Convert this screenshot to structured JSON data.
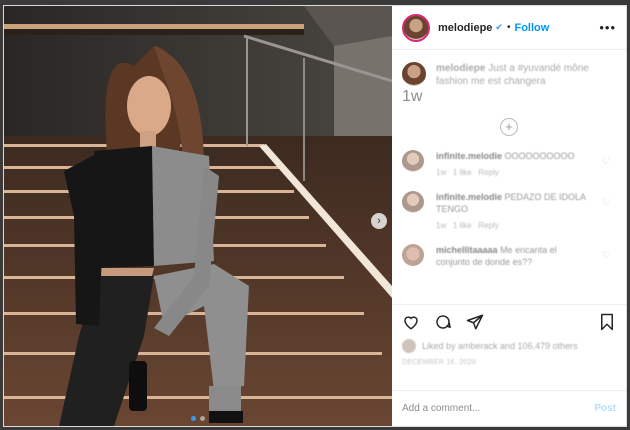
{
  "header": {
    "username": "melodiepe",
    "separator": "•",
    "follow_label": "Follow",
    "more_label": "•••"
  },
  "caption": {
    "username": "melodiepe",
    "text": "Just a #yuvandé mône fashion me est changera",
    "time": "1w"
  },
  "load_more_label": "+",
  "comments": [
    {
      "username": "infinite.melodie",
      "text": "OOOOOOOOOO",
      "time": "1w",
      "likes": "1 like",
      "reply": "Reply"
    },
    {
      "username": "infinite.melodie",
      "text": "PEDAZO DE IDOLA TENGO",
      "time": "1w",
      "likes": "1 like",
      "reply": "Reply"
    },
    {
      "username": "michellitaaaaa",
      "text": "Me encanta el conjunto de donde es??",
      "time": "",
      "likes": "",
      "reply": ""
    }
  ],
  "actions": {
    "likes_text": "Liked by amberack and 106,479 others",
    "date": "DECEMBER 16, 2020"
  },
  "add_comment": {
    "placeholder": "Add a comment...",
    "post_label": "Post"
  },
  "colors": {
    "accent": "#0095f6",
    "verified": "#3897f0",
    "post_disabled": "#b2dffc",
    "story_ring": "#d62976"
  },
  "icons": [
    "heart-icon",
    "comment-icon",
    "share-icon",
    "bookmark-icon",
    "chevron-right-icon",
    "verified-icon"
  ]
}
